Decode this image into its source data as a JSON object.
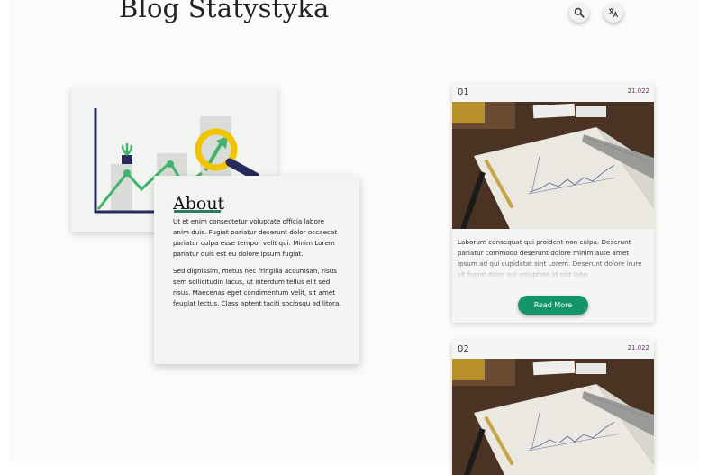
{
  "header": {
    "title": "Blog Statystyka",
    "icons": [
      "search-icon",
      "translate-icon"
    ]
  },
  "about": {
    "title": "About",
    "paragraphs": [
      "Ut et enim consectetur voluptate officia labore anim duis. Fugiat pariatur deserunt dolor occaecat pariatur culpa esse tempor velit qui. Minim Lorem pariatur duis est eu dolore ipsum fugiat.",
      "Sed dignissim, metus nec fringilla accumsan, risus sem sollicitudin lacus, ut interdum tellus elit sed risus. Maecenas eget condimentum velit, sit amet feugiat lectus. Class aptent taciti sociosqu ad litora."
    ]
  },
  "posts": [
    {
      "number": "01",
      "count": "21.022",
      "excerpt": "Laborum consequat qui proident non culpa. Deserunt pariatur commodo deserunt dolore minim aute amet ipsum ad qui cupidatat sint Lorem. Deserunt dolore irure sit fugiat dolor qui voluptate id sint labo",
      "button": "Read More"
    },
    {
      "number": "02",
      "count": "21.022"
    }
  ],
  "colors": {
    "accent": "#13946b",
    "count_text": "#7a2a6e",
    "illus_green": "#3fb56a",
    "illus_yellow": "#f2c300",
    "illus_navy": "#262a5c"
  }
}
